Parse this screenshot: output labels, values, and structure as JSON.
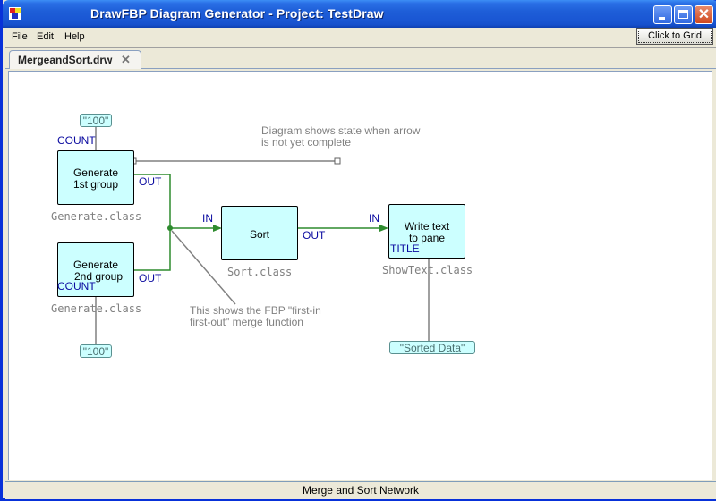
{
  "window": {
    "title": "DrawFBP Diagram Generator - Project: TestDraw",
    "controls": [
      "minimize-icon",
      "maximize-icon",
      "close-icon"
    ]
  },
  "menu": {
    "items": [
      "File",
      "Edit",
      "Help"
    ],
    "grid_button": "Click to Grid"
  },
  "tabs": [
    {
      "label": "MergeandSort.drw",
      "close_icon": "close-icon",
      "active": true
    }
  ],
  "diagram": {
    "processes": [
      {
        "id": "gen1",
        "lines": [
          "Generate",
          "1st group"
        ],
        "class": "Generate.class"
      },
      {
        "id": "gen2",
        "lines": [
          "Generate",
          "2nd group"
        ],
        "class": "Generate.class"
      },
      {
        "id": "sort",
        "lines": [
          "Sort"
        ],
        "class": "Sort.class"
      },
      {
        "id": "show",
        "lines": [
          "Write text",
          "to pane"
        ],
        "class": "ShowText.class"
      }
    ],
    "iips": [
      {
        "value": "\"100\"",
        "target": "gen1",
        "port": "COUNT"
      },
      {
        "value": "\"100\"",
        "target": "gen2",
        "port": "COUNT"
      },
      {
        "value": "\"Sorted Data\"",
        "target": "show",
        "port": "TITLE"
      }
    ],
    "ports": {
      "gen1_in": "COUNT",
      "gen1_out": "OUT",
      "gen2_in": "COUNT",
      "gen2_out": "OUT",
      "sort_in": "IN",
      "sort_out": "OUT",
      "show_in": "IN",
      "show_title": "TITLE"
    },
    "connections": [
      {
        "from": "gen1.OUT",
        "to": "sort.IN"
      },
      {
        "from": "gen2.OUT",
        "to": "sort.IN"
      },
      {
        "from": "sort.OUT",
        "to": "show.IN"
      }
    ],
    "notes": [
      {
        "lines": [
          "Diagram shows state when arrow",
          "is not yet complete"
        ]
      },
      {
        "lines": [
          "This shows the FBP \"first-in",
          "first-out\" merge function"
        ]
      }
    ],
    "colors": {
      "process_fill": "#ccffff",
      "connection": "#2e8b2e",
      "port_label": "#0a0aa0",
      "annotation": "#808080"
    }
  },
  "status": {
    "text": "Merge and Sort Network"
  }
}
